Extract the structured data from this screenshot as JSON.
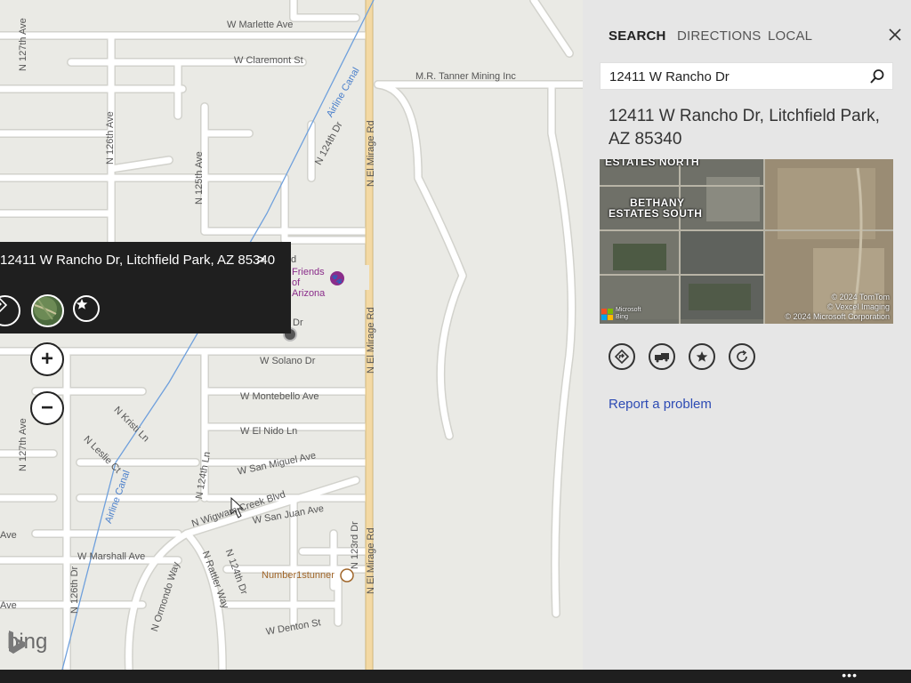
{
  "map": {
    "street_labels": [
      {
        "text": "W Marlette Ave"
      },
      {
        "text": "W Claremont St"
      },
      {
        "text": "M.R. Tanner Mining Inc"
      },
      {
        "text": "Airline Canal"
      },
      {
        "text": "N 124th Dr"
      },
      {
        "text": "N 127th Ave"
      },
      {
        "text": "N 126th Ave"
      },
      {
        "text": "N 125th Ave"
      },
      {
        "text": "N El Mirage Rd"
      },
      {
        "text": "N El Mirage Rd"
      },
      {
        "text": "N El Mirage Rd"
      },
      {
        "text": "W Solano Dr"
      },
      {
        "text": "W Montebello Ave"
      },
      {
        "text": "N Kristi Ln"
      },
      {
        "text": "W El Nido Ln"
      },
      {
        "text": "N Leslie Ct"
      },
      {
        "text": "N 127th Ave"
      },
      {
        "text": "W San Miguel Ave"
      },
      {
        "text": "N 124th Ln"
      },
      {
        "text": "N Wigwam Creek Blvd"
      },
      {
        "text": "Airline Canal"
      },
      {
        "text": "W San Juan Ave"
      },
      {
        "text": "N 123rd Dr"
      },
      {
        "text": "W Marshall Ave"
      },
      {
        "text": "N 124th Dr"
      },
      {
        "text": "N Rattler Way"
      },
      {
        "text": "N 126th Dr"
      },
      {
        "text": "N Ormondo Way"
      },
      {
        "text": "W Denton St"
      },
      {
        "text": "Ave"
      },
      {
        "text": "Ave"
      },
      {
        "text": "Dr"
      },
      {
        "text": "d"
      }
    ],
    "poi": {
      "pet_store": "Friends of Arizona",
      "business": "Number1stunner",
      "pet_color": "#8a2d8a",
      "business_color": "#a0662a"
    },
    "info_bubble": {
      "address": "12411 W Rancho Dr, Litchfield Park, AZ 85340",
      "chevron": ">",
      "buttons": [
        "directions-icon",
        "aerial-view-icon",
        "add-favorite-icon"
      ]
    },
    "zoom": {
      "in": "+",
      "out": "−"
    },
    "bing_logo": "bing"
  },
  "panel": {
    "tabs": [
      {
        "label": "SEARCH",
        "active": true
      },
      {
        "label": "DIRECTIONS",
        "active": false
      },
      {
        "label": "LOCAL",
        "active": false
      }
    ],
    "close_icon": "close-icon",
    "search": {
      "value": "12411 W Rancho Dr",
      "icon": "search-icon"
    },
    "result_title": "12411 W Rancho Dr, Litchfield Park, AZ 85340",
    "aerial": {
      "labels": [
        "ESTATES NORTH",
        "BETHANY",
        "ESTATES SOUTH"
      ],
      "copyright": [
        "© 2024 TomTom",
        "© Vexcel Imaging",
        "© 2024 Microsoft Corporation"
      ],
      "brand": [
        "Microsoft",
        "Bing"
      ]
    },
    "actions": [
      {
        "icon": "directions-icon"
      },
      {
        "icon": "nearby-traffic-icon"
      },
      {
        "icon": "add-favorite-icon"
      },
      {
        "icon": "refresh-icon"
      }
    ],
    "report_link": "Report a problem"
  },
  "app_bar": {
    "more": "•••"
  },
  "colors": {
    "map_bg": "#eaeae5",
    "road": "#ffffff",
    "road_casing": "#d2d2cc",
    "highway": "#f3d9a4",
    "canal": "#6fa0dc",
    "panel_bg": "#e6e6e6",
    "bubble_bg": "#1f1f1f",
    "link": "#2d4bb4"
  }
}
